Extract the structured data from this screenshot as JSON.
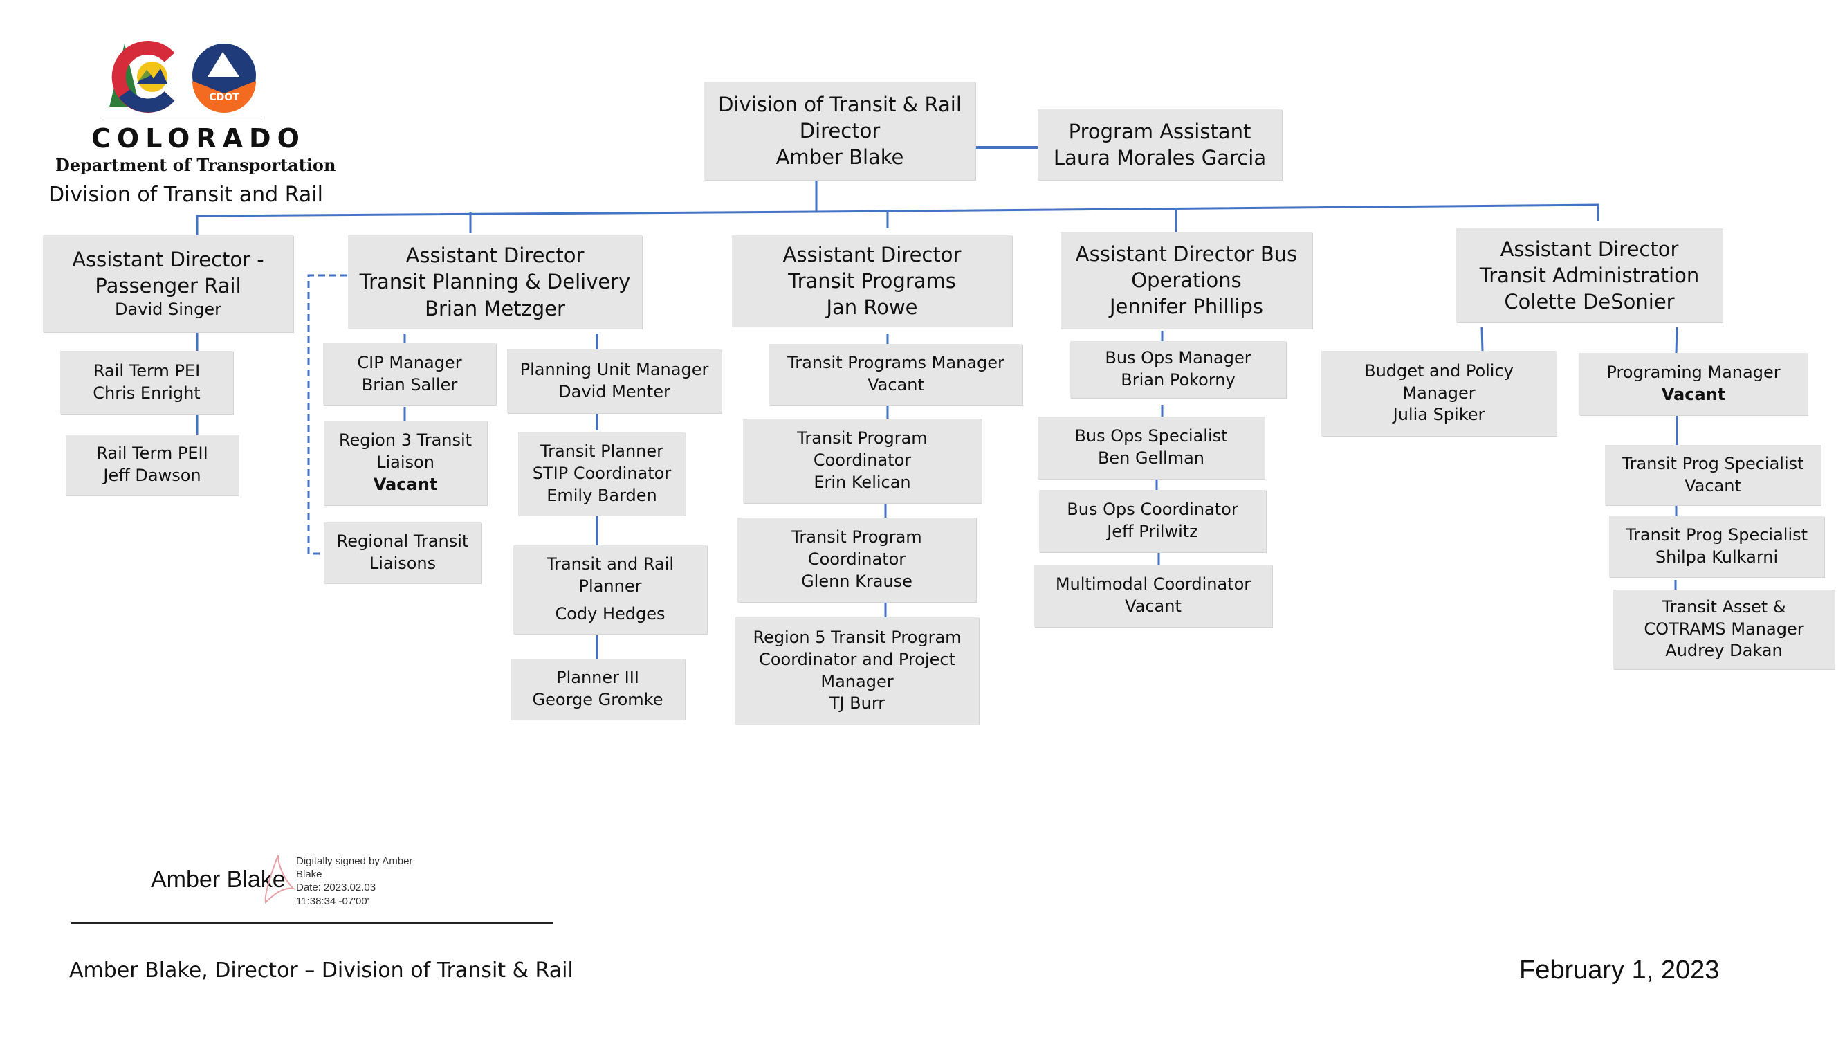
{
  "header": {
    "logo_wordmark": "COLORADO",
    "logo_badge": "CDOT",
    "department": "Department of Transportation",
    "division": "Division of Transit and Rail"
  },
  "colors": {
    "box_fill": "#e6e6e6",
    "connector": "#4472c4",
    "logo_green": "#2e7d3a",
    "logo_red": "#d62b3a",
    "logo_navy": "#1f3b7a",
    "logo_yellow": "#f2c318",
    "logo_orange": "#f26b21"
  },
  "org": {
    "director": {
      "lines": [
        "Division of Transit & Rail",
        "Director",
        "Amber Blake"
      ]
    },
    "assistant": {
      "lines": [
        "Program Assistant",
        "Laura Morales Garcia"
      ]
    },
    "units": [
      {
        "head": {
          "lines": [
            "Assistant Director -",
            "Passenger Rail",
            "David Singer"
          ]
        },
        "staff": [
          {
            "lines": [
              "Rail Term PEI",
              "Chris Enright"
            ]
          },
          {
            "lines": [
              "Rail Term PEII",
              "Jeff Dawson"
            ]
          }
        ]
      },
      {
        "head": {
          "lines": [
            "Assistant Director",
            "Transit Planning & Delivery",
            "Brian Metzger"
          ]
        },
        "left_staff": [
          {
            "lines": [
              "CIP Manager",
              "Brian Saller"
            ]
          },
          {
            "lines": [
              "Region 3  Transit",
              "Liaison",
              "Vacant"
            ],
            "bold_last": true
          },
          {
            "lines": [
              "Regional Transit",
              "Liaisons"
            ],
            "dotted_link": true
          }
        ],
        "right_staff": [
          {
            "lines": [
              "Planning Unit Manager",
              "David Menter"
            ]
          },
          {
            "lines": [
              "Transit Planner",
              "STIP Coordinator",
              "Emily Barden"
            ]
          },
          {
            "lines": [
              "Transit and Rail",
              "Planner",
              "Cody Hedges"
            ]
          },
          {
            "lines": [
              "Planner III",
              "George Gromke"
            ]
          }
        ]
      },
      {
        "head": {
          "lines": [
            "Assistant Director",
            "Transit Programs",
            "Jan Rowe"
          ]
        },
        "staff": [
          {
            "lines": [
              "Transit Programs Manager",
              "Vacant"
            ]
          },
          {
            "lines": [
              "Transit Program",
              "Coordinator",
              "Erin Kelican"
            ]
          },
          {
            "lines": [
              "Transit Program",
              "Coordinator",
              "Glenn Krause"
            ]
          },
          {
            "lines": [
              "Region 5  Transit Program",
              "Coordinator and Project",
              "Manager",
              "TJ Burr"
            ]
          }
        ]
      },
      {
        "head": {
          "lines": [
            "Assistant Director Bus",
            "Operations",
            "Jennifer Phillips"
          ]
        },
        "staff": [
          {
            "lines": [
              "Bus Ops Manager",
              "Brian Pokorny"
            ]
          },
          {
            "lines": [
              "Bus Ops Specialist",
              "Ben Gellman"
            ]
          },
          {
            "lines": [
              "Bus Ops Coordinator",
              "Jeff Prilwitz"
            ]
          },
          {
            "lines": [
              "Multimodal Coordinator",
              "Vacant"
            ]
          }
        ]
      },
      {
        "head": {
          "lines": [
            "Assistant Director",
            "Transit Administration",
            "Colette DeSonier"
          ]
        },
        "left_staff": [
          {
            "lines": [
              "Budget and Policy",
              "Manager",
              "Julia Spiker"
            ]
          }
        ],
        "right_staff": [
          {
            "lines": [
              "Programing Manager",
              "Vacant"
            ],
            "bold_last": true
          },
          {
            "lines": [
              "Transit Prog Specialist",
              "Vacant"
            ]
          },
          {
            "lines": [
              "Transit Prog Specialist",
              "Shilpa Kulkarni"
            ]
          },
          {
            "lines": [
              "Transit Asset &",
              "COTRAMS Manager",
              "Audrey Dakan"
            ]
          }
        ]
      }
    ]
  },
  "signature": {
    "name": "Amber Blake",
    "meta": [
      "Digitally signed by Amber",
      "Blake",
      "Date: 2023.02.03",
      "11:38:34 -07'00'"
    ],
    "caption": "Amber Blake, Director – Division of Transit & Rail"
  },
  "date": "February 1, 2023"
}
